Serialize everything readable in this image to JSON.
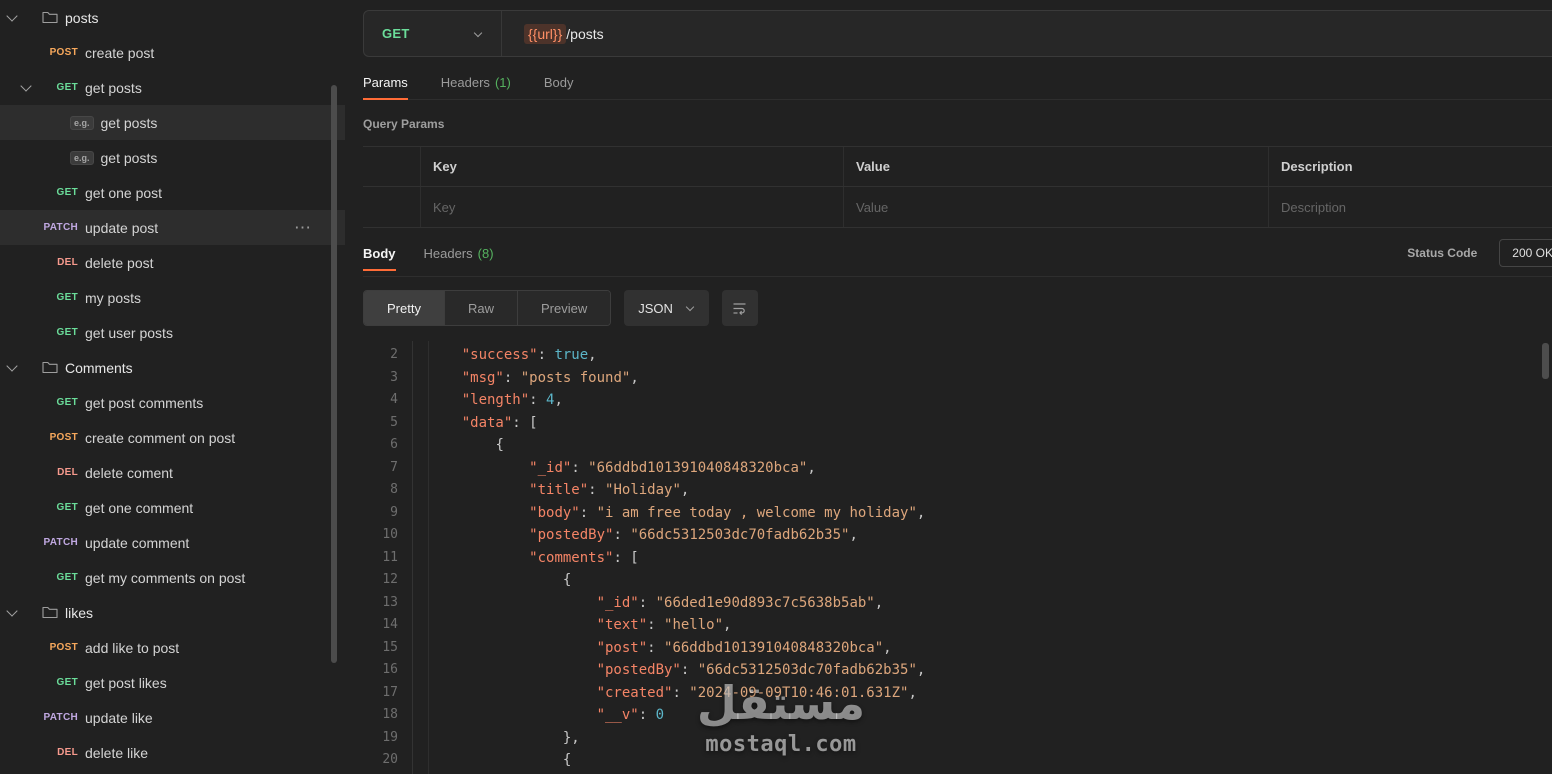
{
  "colors": {
    "accent": "#ff6c37",
    "method_get": "#6bdd9a",
    "method_post": "#f7a85c",
    "method_patch": "#c0a8e1",
    "method_del": "#f79a8e",
    "count_green": "#55b25f",
    "json_key": "#f48466",
    "json_string": "#dda67c",
    "json_literal": "#5cb6c9"
  },
  "sidebar": {
    "items": [
      {
        "kind": "folder",
        "label": "posts",
        "expanded": true
      },
      {
        "kind": "request",
        "method": "POST",
        "label": "create post"
      },
      {
        "kind": "request",
        "method": "GET",
        "label": "get posts",
        "chevron": true,
        "expanded": true
      },
      {
        "kind": "example",
        "label": "get posts",
        "selected": true
      },
      {
        "kind": "example",
        "label": "get posts"
      },
      {
        "kind": "request",
        "method": "GET",
        "label": "get one post"
      },
      {
        "kind": "request",
        "method": "PATCH",
        "label": "update post",
        "hovered": true
      },
      {
        "kind": "request",
        "method": "DEL",
        "label": "delete post"
      },
      {
        "kind": "request",
        "method": "GET",
        "label": "my posts"
      },
      {
        "kind": "request",
        "method": "GET",
        "label": "get user posts"
      },
      {
        "kind": "folder",
        "label": "Comments",
        "expanded": true
      },
      {
        "kind": "request",
        "method": "GET",
        "label": "get post comments"
      },
      {
        "kind": "request",
        "method": "POST",
        "label": "create comment on post"
      },
      {
        "kind": "request",
        "method": "DEL",
        "label": "delete coment"
      },
      {
        "kind": "request",
        "method": "GET",
        "label": "get one comment"
      },
      {
        "kind": "request",
        "method": "PATCH",
        "label": "update comment"
      },
      {
        "kind": "request",
        "method": "GET",
        "label": "get my comments on post"
      },
      {
        "kind": "folder",
        "label": "likes",
        "expanded": true
      },
      {
        "kind": "request",
        "method": "POST",
        "label": "add like to post"
      },
      {
        "kind": "request",
        "method": "GET",
        "label": "get post likes"
      },
      {
        "kind": "request",
        "method": "PATCH",
        "label": "update like"
      },
      {
        "kind": "request",
        "method": "DEL",
        "label": "delete like"
      }
    ]
  },
  "request": {
    "method": "GET",
    "url_variable": "{{url}}",
    "url_path": "/posts",
    "tabs": [
      {
        "label": "Params",
        "active": true
      },
      {
        "label": "Headers",
        "count": "(1)"
      },
      {
        "label": "Body"
      }
    ],
    "section_title": "Query Params",
    "table": {
      "headers": [
        "Key",
        "Value",
        "Description"
      ],
      "placeholders": [
        "Key",
        "Value",
        "Description"
      ]
    }
  },
  "response": {
    "tabs": [
      {
        "label": "Body",
        "active": true
      },
      {
        "label": "Headers",
        "count": "(8)"
      }
    ],
    "status_label": "Status Code",
    "status_value": "200 OK",
    "view_modes": [
      "Pretty",
      "Raw",
      "Preview"
    ],
    "active_mode": "Pretty",
    "format": "JSON",
    "code_lines": [
      {
        "n": 2,
        "ind": 4,
        "t": [
          [
            "k",
            "\"success\""
          ],
          [
            "p",
            ": "
          ],
          [
            "v",
            "true"
          ],
          [
            "p",
            ","
          ]
        ]
      },
      {
        "n": 3,
        "ind": 4,
        "t": [
          [
            "k",
            "\"msg\""
          ],
          [
            "p",
            ": "
          ],
          [
            "s",
            "\"posts found\""
          ],
          [
            "p",
            ","
          ]
        ]
      },
      {
        "n": 4,
        "ind": 4,
        "t": [
          [
            "k",
            "\"length\""
          ],
          [
            "p",
            ": "
          ],
          [
            "v",
            "4"
          ],
          [
            "p",
            ","
          ]
        ]
      },
      {
        "n": 5,
        "ind": 4,
        "t": [
          [
            "k",
            "\"data\""
          ],
          [
            "p",
            ": ["
          ]
        ]
      },
      {
        "n": 6,
        "ind": 8,
        "t": [
          [
            "p",
            "{"
          ]
        ]
      },
      {
        "n": 7,
        "ind": 12,
        "t": [
          [
            "k",
            "\"_id\""
          ],
          [
            "p",
            ": "
          ],
          [
            "s",
            "\"66ddbd101391040848320bca\""
          ],
          [
            "p",
            ","
          ]
        ]
      },
      {
        "n": 8,
        "ind": 12,
        "t": [
          [
            "k",
            "\"title\""
          ],
          [
            "p",
            ": "
          ],
          [
            "s",
            "\"Holiday\""
          ],
          [
            "p",
            ","
          ]
        ]
      },
      {
        "n": 9,
        "ind": 12,
        "t": [
          [
            "k",
            "\"body\""
          ],
          [
            "p",
            ": "
          ],
          [
            "s",
            "\"i am free today , welcome my holiday\""
          ],
          [
            "p",
            ","
          ]
        ]
      },
      {
        "n": 10,
        "ind": 12,
        "t": [
          [
            "k",
            "\"postedBy\""
          ],
          [
            "p",
            ": "
          ],
          [
            "s",
            "\"66dc5312503dc70fadb62b35\""
          ],
          [
            "p",
            ","
          ]
        ]
      },
      {
        "n": 11,
        "ind": 12,
        "t": [
          [
            "k",
            "\"comments\""
          ],
          [
            "p",
            ": ["
          ]
        ]
      },
      {
        "n": 12,
        "ind": 16,
        "t": [
          [
            "p",
            "{"
          ]
        ]
      },
      {
        "n": 13,
        "ind": 20,
        "t": [
          [
            "k",
            "\"_id\""
          ],
          [
            "p",
            ": "
          ],
          [
            "s",
            "\"66ded1e90d893c7c5638b5ab\""
          ],
          [
            "p",
            ","
          ]
        ]
      },
      {
        "n": 14,
        "ind": 20,
        "t": [
          [
            "k",
            "\"text\""
          ],
          [
            "p",
            ": "
          ],
          [
            "s",
            "\"hello\""
          ],
          [
            "p",
            ","
          ]
        ]
      },
      {
        "n": 15,
        "ind": 20,
        "t": [
          [
            "k",
            "\"post\""
          ],
          [
            "p",
            ": "
          ],
          [
            "s",
            "\"66ddbd101391040848320bca\""
          ],
          [
            "p",
            ","
          ]
        ]
      },
      {
        "n": 16,
        "ind": 20,
        "t": [
          [
            "k",
            "\"postedBy\""
          ],
          [
            "p",
            ": "
          ],
          [
            "s",
            "\"66dc5312503dc70fadb62b35\""
          ],
          [
            "p",
            ","
          ]
        ]
      },
      {
        "n": 17,
        "ind": 20,
        "t": [
          [
            "k",
            "\"created\""
          ],
          [
            "p",
            ": "
          ],
          [
            "s",
            "\"2024-09-09T10:46:01.631Z\""
          ],
          [
            "p",
            ","
          ]
        ]
      },
      {
        "n": 18,
        "ind": 20,
        "t": [
          [
            "k",
            "\"__v\""
          ],
          [
            "p",
            ": "
          ],
          [
            "v",
            "0"
          ]
        ]
      },
      {
        "n": 19,
        "ind": 16,
        "t": [
          [
            "p",
            "},"
          ]
        ]
      },
      {
        "n": 20,
        "ind": 16,
        "t": [
          [
            "p",
            "{"
          ]
        ]
      }
    ]
  },
  "watermark": {
    "arabic": "مستقل",
    "latin": "mostaql.com"
  }
}
